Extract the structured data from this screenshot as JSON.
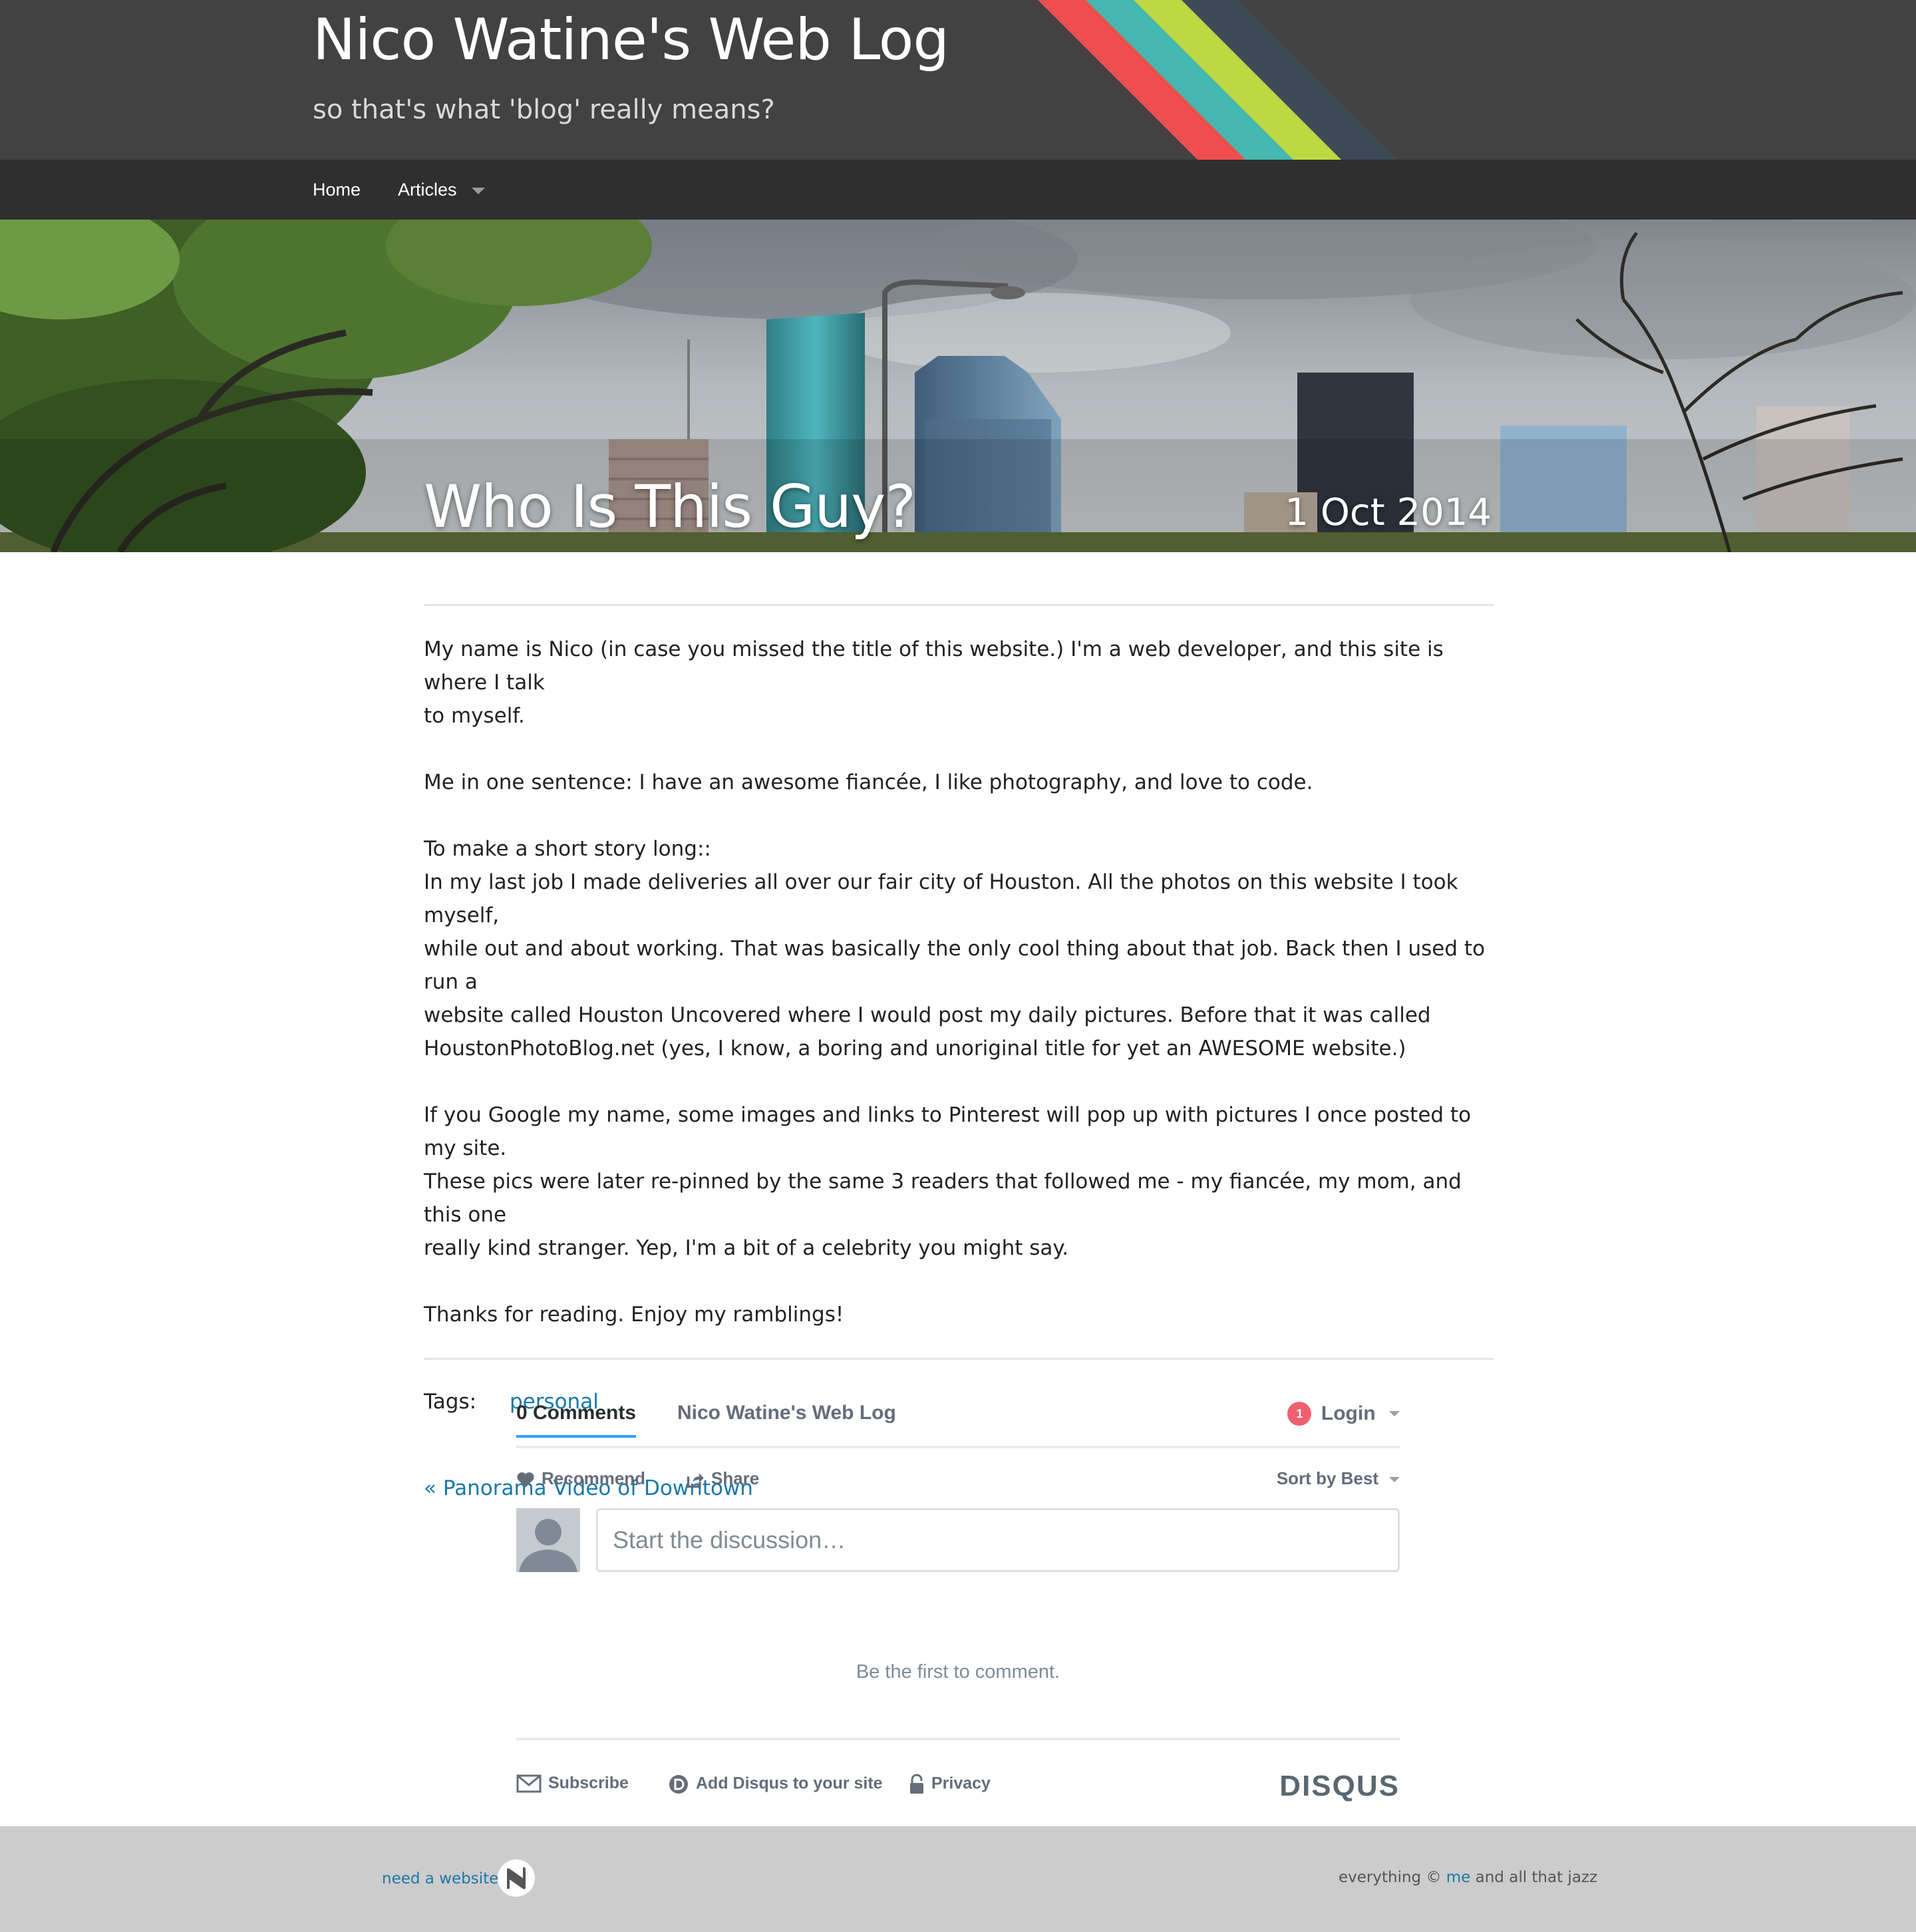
{
  "header": {
    "title": "Nico Watine's Web Log",
    "tagline": "so that's what 'blog' really means?",
    "stripe_colors": [
      "#f04e4e",
      "#46b8b0",
      "#bdd843",
      "#3d4a56"
    ]
  },
  "nav": {
    "home_label": "Home",
    "articles_label": "Articles"
  },
  "post": {
    "title": "Who Is This Guy?",
    "date": "1 Oct 2014",
    "paragraphs": [
      [
        "My name is Nico (in case you missed the title of this website.) I'm a web developer, and this site is where I talk",
        "to myself."
      ],
      [
        "Me in one sentence: I have an awesome fiancée, I like photography, and love to code."
      ],
      [
        "To make a short story long::",
        "In my last job I made deliveries all over our fair city of Houston. All the photos on this website I took myself,",
        "while out and about working. That was basically the only cool thing about that job. Back then I used to run a",
        "website called Houston Uncovered where I would post my daily pictures. Before that it was called",
        "HoustonPhotoBlog.net (yes, I know, a boring and unoriginal title for yet an AWESOME website.)"
      ],
      [
        "If you Google my name, some images and links to Pinterest will pop up with pictures I once posted to my site.",
        "These pics were later re-pinned by the same 3 readers that followed me - my fiancée, my mom, and this one",
        "really kind stranger. Yep, I'm a bit of a celebrity you might say."
      ],
      [
        "Thanks for reading. Enjoy my ramblings!"
      ]
    ],
    "tags_label": "Tags:",
    "tags": [
      "personal"
    ],
    "prev_post": "« Panorama Video of Downtown"
  },
  "disqus": {
    "comments_tab": "0 Comments",
    "site_tab": "Nico Watine's Web Log",
    "login_badge": "1",
    "login_label": "Login",
    "recommend_label": "Recommend",
    "share_label": "Share",
    "sort_label": "Sort by Best",
    "input_placeholder": "Start the discussion…",
    "empty_message": "Be the first to comment.",
    "subscribe_label": "Subscribe",
    "add_label": "Add Disqus to your site",
    "privacy_label": "Privacy",
    "logo_text": "DISQUS"
  },
  "footer": {
    "need_website": "need a website?",
    "copyright_prefix": "everything © ",
    "copyright_link": "me",
    "copyright_suffix": " and all that jazz"
  }
}
